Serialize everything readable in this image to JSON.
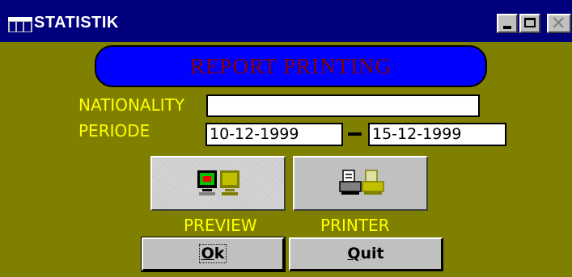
{
  "window": {
    "title": "STATISTIK"
  },
  "banner": {
    "title": "REPORT PRINTING"
  },
  "form": {
    "nationality_label": "NATIONALITY",
    "nationality_value": "",
    "periode_label": "PERIODE",
    "from_date": "10-12-1999",
    "to_date": "15-12-1999",
    "separator": "–"
  },
  "output": {
    "preview_label": "PREVIEW",
    "printer_label": "PRINTER",
    "selected": "preview",
    "preview_icon": "monitor-icon",
    "printer_icon": "printer-icon"
  },
  "buttons": {
    "ok_label_first": "O",
    "ok_label_rest": "k",
    "quit_label_first": "Q",
    "quit_label_rest": "uit"
  },
  "colors": {
    "window_bg": "#808000",
    "titlebar": "#00007c",
    "banner_bg": "#0000ff",
    "banner_text": "#800000",
    "label_text": "#ffff00"
  }
}
